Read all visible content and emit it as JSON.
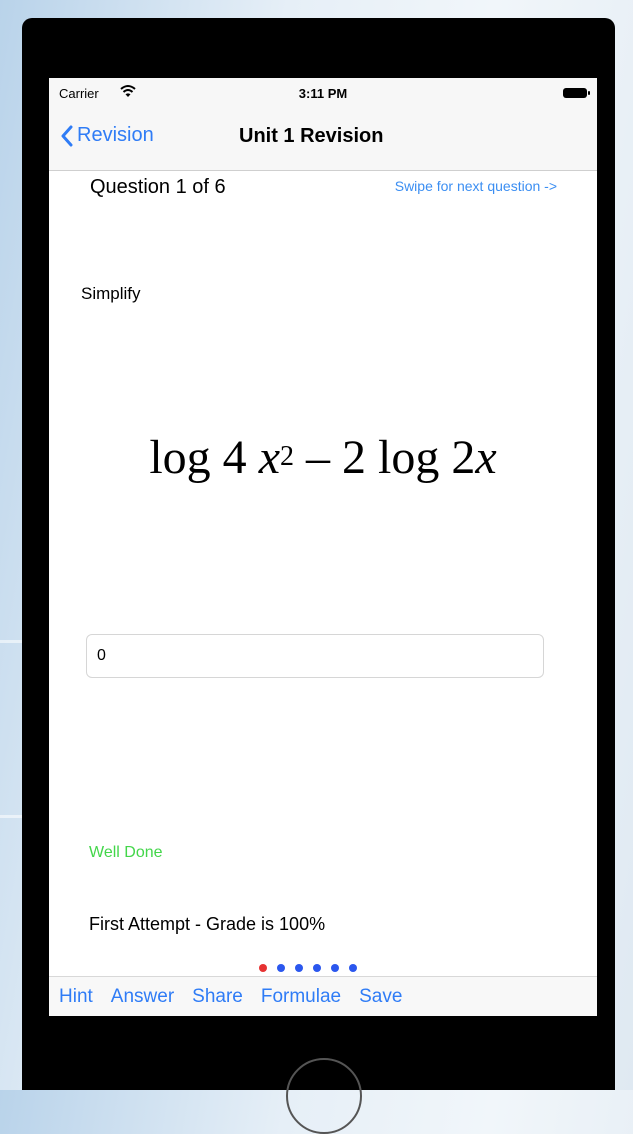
{
  "status_bar": {
    "carrier": "Carrier",
    "time": "3:11 PM"
  },
  "nav": {
    "back_label": "Revision",
    "title": "Unit 1 Revision"
  },
  "question": {
    "counter": "Question 1 of 6",
    "swipe_hint": "Swipe for next question ->",
    "prompt": "Simplify",
    "equation": {
      "term1": "log 4",
      "var1": "x",
      "exp1": "2",
      "middle": "– 2 log 2",
      "var2": "x"
    }
  },
  "answer_field": {
    "value": "0"
  },
  "feedback": {
    "message": "Well Done",
    "color": "#43d64a",
    "grade": "First Attempt - Grade is 100%"
  },
  "pager": {
    "total": 6,
    "current": 1,
    "active_color": "#e63232",
    "inactive_color": "#2b57ee"
  },
  "toolbar": {
    "hint": "Hint",
    "answer": "Answer",
    "share": "Share",
    "formulae": "Formulae",
    "save": "Save"
  },
  "accent_color": "#2f7cf6",
  "icons": [
    "wifi-icon",
    "battery-icon",
    "chevron-left-icon"
  ]
}
